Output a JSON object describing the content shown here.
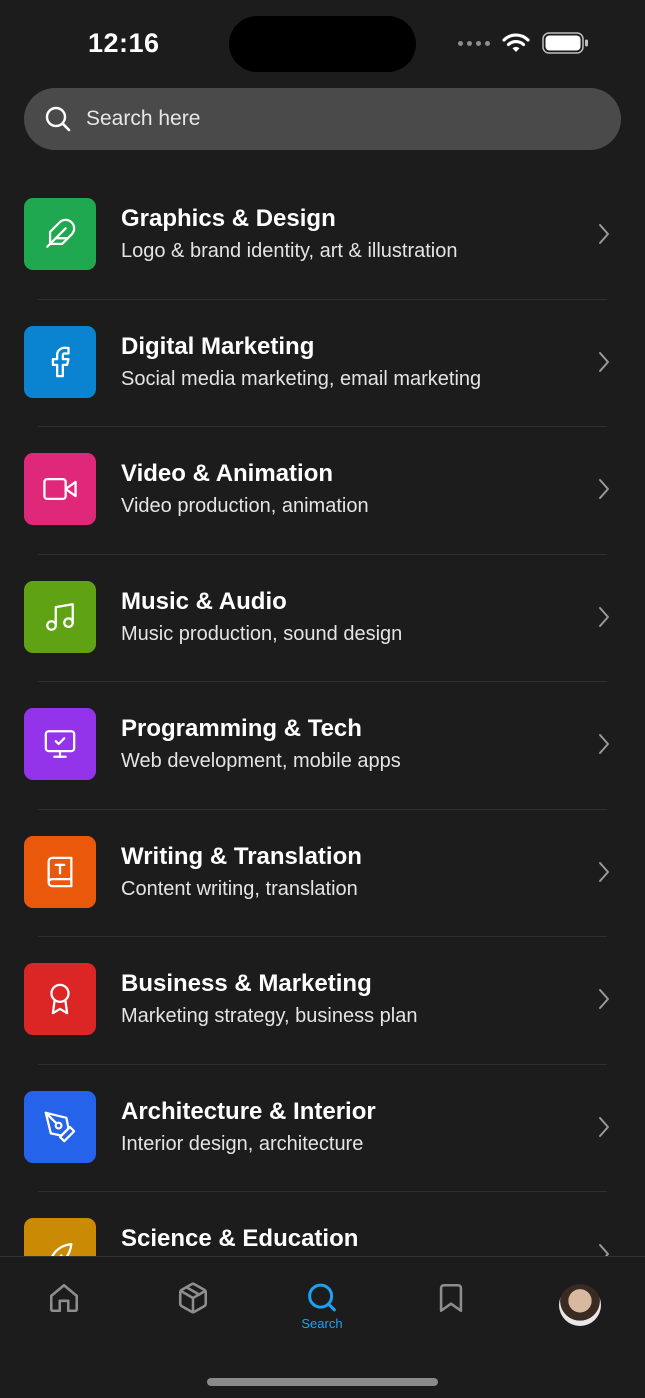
{
  "status": {
    "time": "12:16"
  },
  "search": {
    "placeholder": "Search here"
  },
  "categories": [
    {
      "title": "Graphics & Design",
      "subtitle": "Logo & brand identity, art & illustration",
      "color": "#1fa84f",
      "icon": "feather-icon"
    },
    {
      "title": "Digital Marketing",
      "subtitle": "Social media marketing, email marketing",
      "color": "#0a84d0",
      "icon": "facebook-icon"
    },
    {
      "title": "Video & Animation",
      "subtitle": "Video production, animation",
      "color": "#e0287a",
      "icon": "video-camera-icon"
    },
    {
      "title": "Music & Audio",
      "subtitle": "Music production, sound design",
      "color": "#5fa314",
      "icon": "music-note-icon"
    },
    {
      "title": "Programming & Tech",
      "subtitle": "Web development, mobile apps",
      "color": "#9333ea",
      "icon": "monitor-icon"
    },
    {
      "title": "Writing & Translation",
      "subtitle": "Content writing, translation",
      "color": "#ea580c",
      "icon": "book-icon"
    },
    {
      "title": "Business & Marketing",
      "subtitle": "Marketing strategy, business plan",
      "color": "#dc2626",
      "icon": "award-icon"
    },
    {
      "title": "Architecture & Interior",
      "subtitle": "Interior design, architecture",
      "color": "#2563eb",
      "icon": "pen-tool-icon"
    },
    {
      "title": "Science & Education",
      "subtitle": "",
      "color": "#ca8a04",
      "icon": "leaf-icon"
    }
  ],
  "tabbar": {
    "items": [
      {
        "icon": "home-icon",
        "label": ""
      },
      {
        "icon": "box-icon",
        "label": ""
      },
      {
        "icon": "search-icon",
        "label": "Search",
        "active": true
      },
      {
        "icon": "bookmark-icon",
        "label": ""
      },
      {
        "icon": "avatar",
        "label": ""
      }
    ],
    "active_color": "#1da1f2"
  }
}
